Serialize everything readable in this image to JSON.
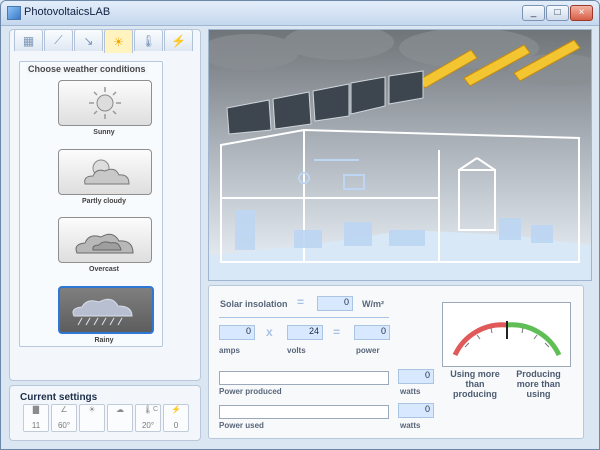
{
  "window": {
    "title": "PhotovoltaicsLAB",
    "controls": [
      "minimize",
      "maximize",
      "close"
    ]
  },
  "tabs": [
    {
      "icon": "layout-grid-icon",
      "active": false
    },
    {
      "icon": "sun-angle-icon",
      "active": false
    },
    {
      "icon": "sun-direction-icon",
      "active": false
    },
    {
      "icon": "sun-icon",
      "active": true
    },
    {
      "icon": "thermometer-icon",
      "active": false
    },
    {
      "icon": "plug-icon",
      "active": false
    }
  ],
  "weather": {
    "heading": "Choose weather conditions",
    "options": [
      {
        "label": "Sunny",
        "icon": "sunny-icon",
        "selected": false
      },
      {
        "label": "Partly cloudy",
        "icon": "partly-cloudy-icon",
        "selected": false
      },
      {
        "label": "Overcast",
        "icon": "overcast-icon",
        "selected": false
      },
      {
        "label": "Rainy",
        "icon": "rainy-icon",
        "selected": true
      }
    ]
  },
  "current": {
    "title": "Current settings",
    "items": [
      {
        "icon": "panel-icon",
        "value": "11"
      },
      {
        "icon": "angle-icon",
        "value": "60°"
      },
      {
        "icon": "sun-icon",
        "value": ""
      },
      {
        "icon": "rainy-icon",
        "value": ""
      },
      {
        "icon": "thermometer-icon",
        "value": "20°",
        "unit": "C"
      },
      {
        "icon": "plug-icon",
        "value": "0"
      }
    ]
  },
  "calc": {
    "insolation_label": "Solar insolation",
    "insolation_value": "0",
    "insolation_unit": "W/m²",
    "amps_value": "0",
    "amps_label": "amps",
    "volts_value": "24",
    "volts_label": "volts",
    "power_value": "0",
    "power_label": "power",
    "op_eq": "=",
    "op_x": "x"
  },
  "output": {
    "produced_label": "Power produced",
    "produced_value": "0",
    "produced_unit": "watts",
    "used_label": "Power used",
    "used_value": "0",
    "used_unit": "watts"
  },
  "meter": {
    "left_caption": "Using more than producing",
    "right_caption": "Producing more than using"
  },
  "colors": {
    "accent": "#2f77d5",
    "meter_red": "#e05a5a",
    "meter_green": "#5fbe55",
    "value_bg": "#d8e9ff"
  }
}
